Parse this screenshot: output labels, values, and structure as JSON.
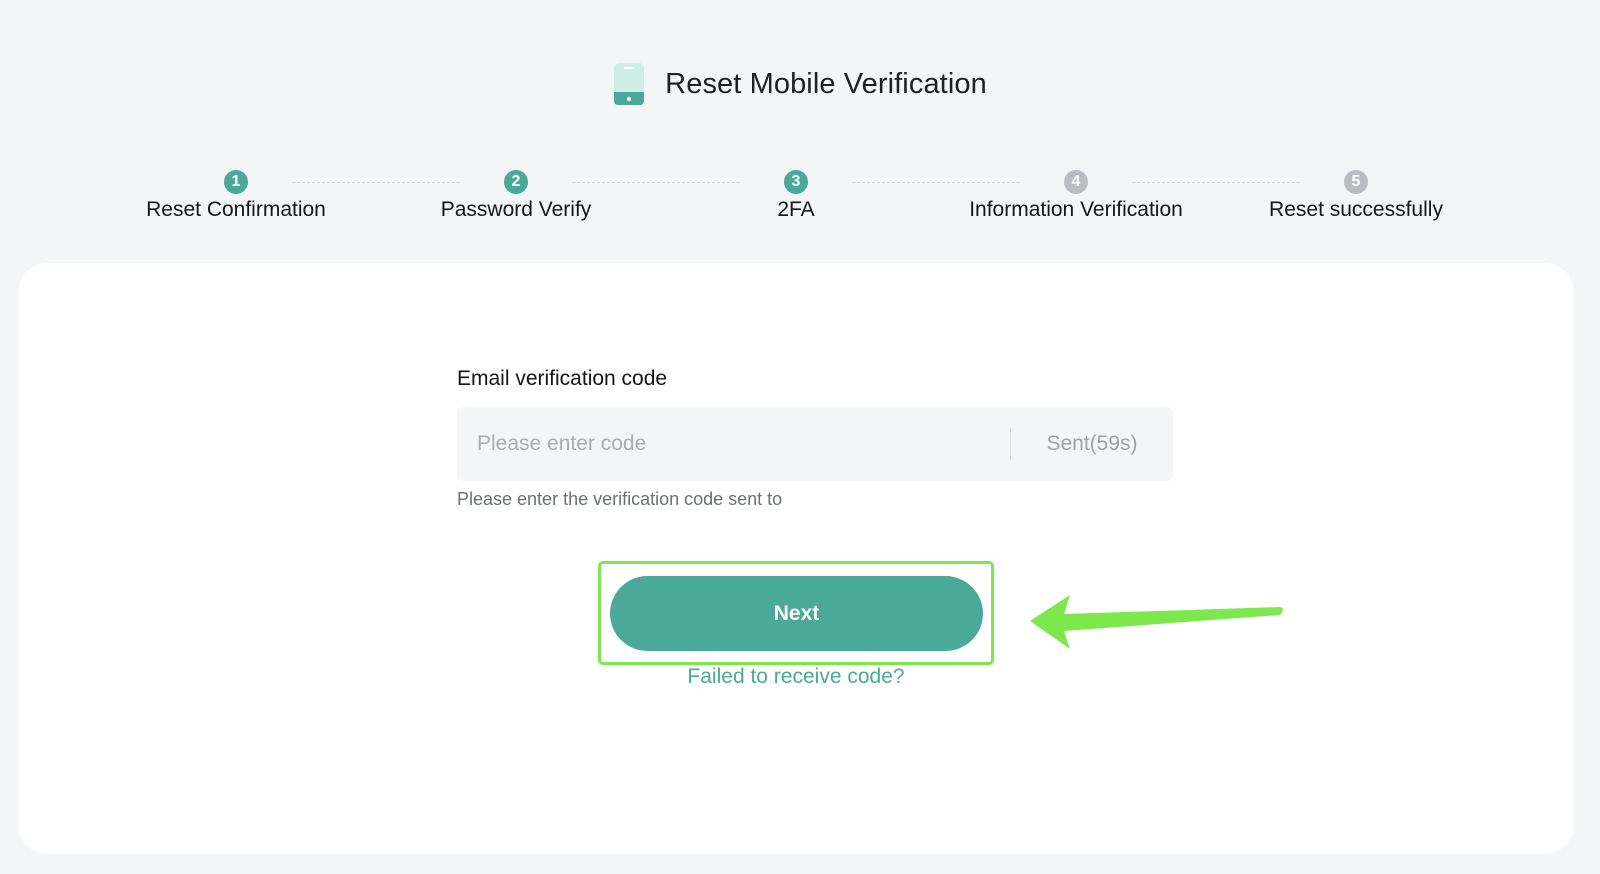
{
  "header": {
    "title": "Reset Mobile Verification",
    "icon": "mobile-phone-icon"
  },
  "steps": [
    {
      "number": "1",
      "label": "Reset Confirmation",
      "status": "done"
    },
    {
      "number": "2",
      "label": "Password Verify",
      "status": "done"
    },
    {
      "number": "3",
      "label": "2FA",
      "status": "current"
    },
    {
      "number": "4",
      "label": "Information Verification",
      "status": "pending"
    },
    {
      "number": "5",
      "label": "Reset successfully",
      "status": "pending"
    }
  ],
  "form": {
    "field_label": "Email verification code",
    "input_placeholder": "Please enter code",
    "input_value": "",
    "sent_label": "Sent(59s)",
    "hint": "Please enter the verification code sent to"
  },
  "actions": {
    "next_label": "Next",
    "resend_link": "Failed to receive code?"
  },
  "colors": {
    "accent": "#4aa998",
    "pending_step": "#b9bdc2",
    "highlight": "#7ce84b",
    "background": "#f4f5f6"
  }
}
